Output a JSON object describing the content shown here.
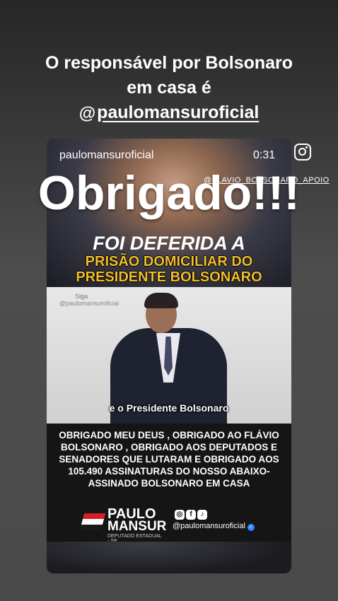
{
  "caption": {
    "line1": "O responsável por Bolsonaro",
    "line2": "em casa é",
    "mention": "paulomansuroficial"
  },
  "reel": {
    "username": "paulomansuroficial",
    "time": "0:31"
  },
  "sticker": "@FLAVIO_BOLSONARO_APOIO",
  "overlay_word": "Obrigado!!!",
  "headline": {
    "line1": "FOI DEFERIDA A",
    "line2": "PRISÃO DOMICILIAR DO",
    "line3": "PRESIDENTE BOLSONARO"
  },
  "video": {
    "siga": "Siga",
    "handle": "@paulomansuroficial",
    "subtitle": "e o Presidente Bolsonaro"
  },
  "body_text": "OBRIGADO MEU DEUS , OBRIGADO AO FLÁVIO BOLSONARO , OBRIGADO AOS DEPUTADOS E SENADORES QUE LUTARAM E OBRIGADO AOS 105.490 ASSINATURAS DO NOSSO ABAIXO-ASSINADO BOLSONARO EM CASA",
  "brand": {
    "name1": "PAULO",
    "name2": "MANSUR",
    "subtitle": "DEPUTADO ESTADUAL - SP"
  },
  "social": {
    "handle": "@paulomansuroficial",
    "icons": [
      "instagram-icon",
      "facebook-icon",
      "tiktok-icon"
    ]
  },
  "colors": {
    "headline_yellow": "#f3bf2a",
    "flag_red": "#d71e28"
  }
}
